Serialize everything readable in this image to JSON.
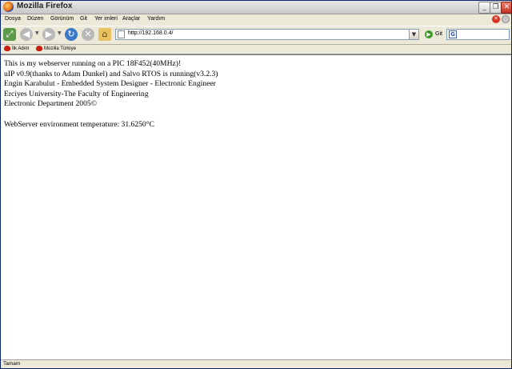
{
  "window": {
    "title": "Mozilla Firefox"
  },
  "menu": [
    "Dosya",
    "Düzen",
    "Görünüm",
    "Git",
    "Yer imleri",
    "Araçlar",
    "Yardım"
  ],
  "nav": {
    "url": "http://192.168.0.4/",
    "go_label": "Git",
    "search_value": ""
  },
  "bookmarks": [
    "İlk Adım",
    "Mozilla Türkiye"
  ],
  "content": {
    "lines": [
      "This is my webserver running on a PIC 18F452(40MHz)!",
      "uIP v0.9(thanks to Adam Dunkel) and Salvo RTOS is running(v3.2.3)",
      "Engin Karabulut - Embedded System Designer - Electronic Engineer",
      "Erciyes University-The Faculty of Engineering",
      "Electronic Department 2005©",
      "",
      "WebServer environment temperature: 31.6250°C"
    ]
  },
  "status": {
    "text": "Tamam"
  }
}
